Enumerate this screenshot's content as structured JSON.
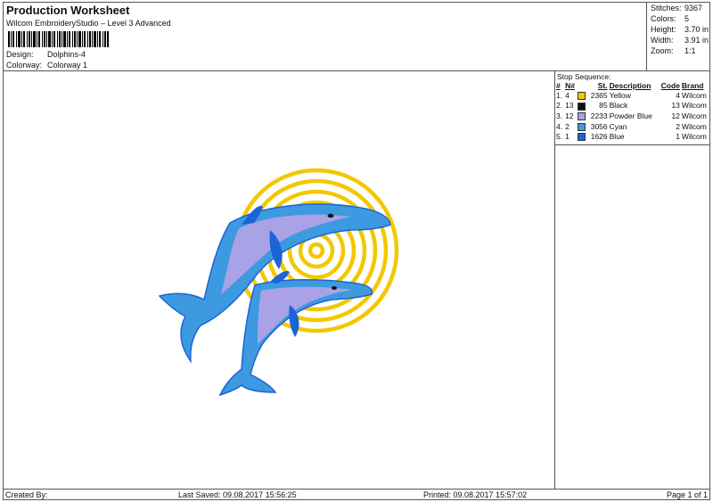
{
  "header": {
    "title": "Production Worksheet",
    "subtitle": "Wilcom EmbroideryStudio – Level 3 Advanced",
    "design_label": "Design:",
    "design_value": "Dolphins-4",
    "colorway_label": "Colorway:",
    "colorway_value": "Colorway 1"
  },
  "stats": {
    "stitches_label": "Stitches:",
    "stitches_value": "9367",
    "colors_label": "Colors:",
    "colors_value": "5",
    "height_label": "Height:",
    "height_value": "3.70 in",
    "width_label": "Width:",
    "width_value": "3.91 in",
    "zoom_label": "Zoom:",
    "zoom_value": "1:1"
  },
  "stop_sequence": {
    "heading": "Stop Sequence:",
    "columns": {
      "index": "#",
      "needle": "N#",
      "st": "St.",
      "description": "Description",
      "code": "Code",
      "brand": "Brand"
    },
    "rows": [
      {
        "index": "1.",
        "needle": "4",
        "swatch": "#f2c800",
        "st": "2365",
        "description": "Yellow",
        "code": "4",
        "brand": "Wilcom"
      },
      {
        "index": "2.",
        "needle": "13",
        "swatch": "#111111",
        "st": "85",
        "description": "Black",
        "code": "13",
        "brand": "Wilcom"
      },
      {
        "index": "3.",
        "needle": "12",
        "swatch": "#a9a2e6",
        "st": "2233",
        "description": "Powder Blue",
        "code": "12",
        "brand": "Wilcom"
      },
      {
        "index": "4.",
        "needle": "2",
        "swatch": "#3d9ae0",
        "st": "3056",
        "description": "Cyan",
        "code": "2",
        "brand": "Wilcom"
      },
      {
        "index": "5.",
        "needle": "1",
        "swatch": "#1c64d6",
        "st": "1626",
        "description": "Blue",
        "code": "1",
        "brand": "Wilcom"
      }
    ]
  },
  "footer": {
    "created_by": "Created By:",
    "last_saved": "Last Saved: 09.08.2017 15:56:25",
    "printed": "Printed: 09.08.2017 15:57:02",
    "page": "Page 1 of 1"
  },
  "colors": {
    "yellow": "#f2c800",
    "black": "#111111",
    "powder_blue": "#a9a2e6",
    "cyan": "#3d9ae0",
    "blue": "#1c64d6"
  }
}
